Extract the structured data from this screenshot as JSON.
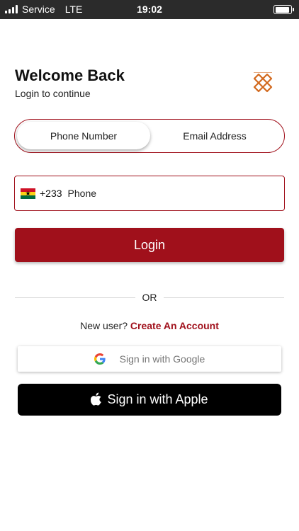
{
  "status_bar": {
    "carrier": "Service",
    "network": "LTE",
    "time": "19:02"
  },
  "header": {
    "title": "Welcome Back",
    "subtitle": "Login to continue"
  },
  "login_method_tabs": {
    "phone_label": "Phone Number",
    "email_label": "Email Address",
    "selected": "Phone Number"
  },
  "phone_field": {
    "country_flag": "ghana-flag-icon",
    "dial_code": "+233",
    "placeholder": "Phone",
    "value": ""
  },
  "login_button": {
    "label": "Login"
  },
  "divider": {
    "label": "OR"
  },
  "signup": {
    "prompt": "New user?",
    "link_label": "Create An Account"
  },
  "google_button": {
    "label": "Sign in with Google",
    "icon": "google-icon"
  },
  "apple_button": {
    "label": "Sign in with Apple",
    "icon": "apple-icon"
  },
  "colors": {
    "brand": "#a0101b",
    "logo": "#d2691e",
    "status_bar_bg": "#2b2b2b"
  }
}
